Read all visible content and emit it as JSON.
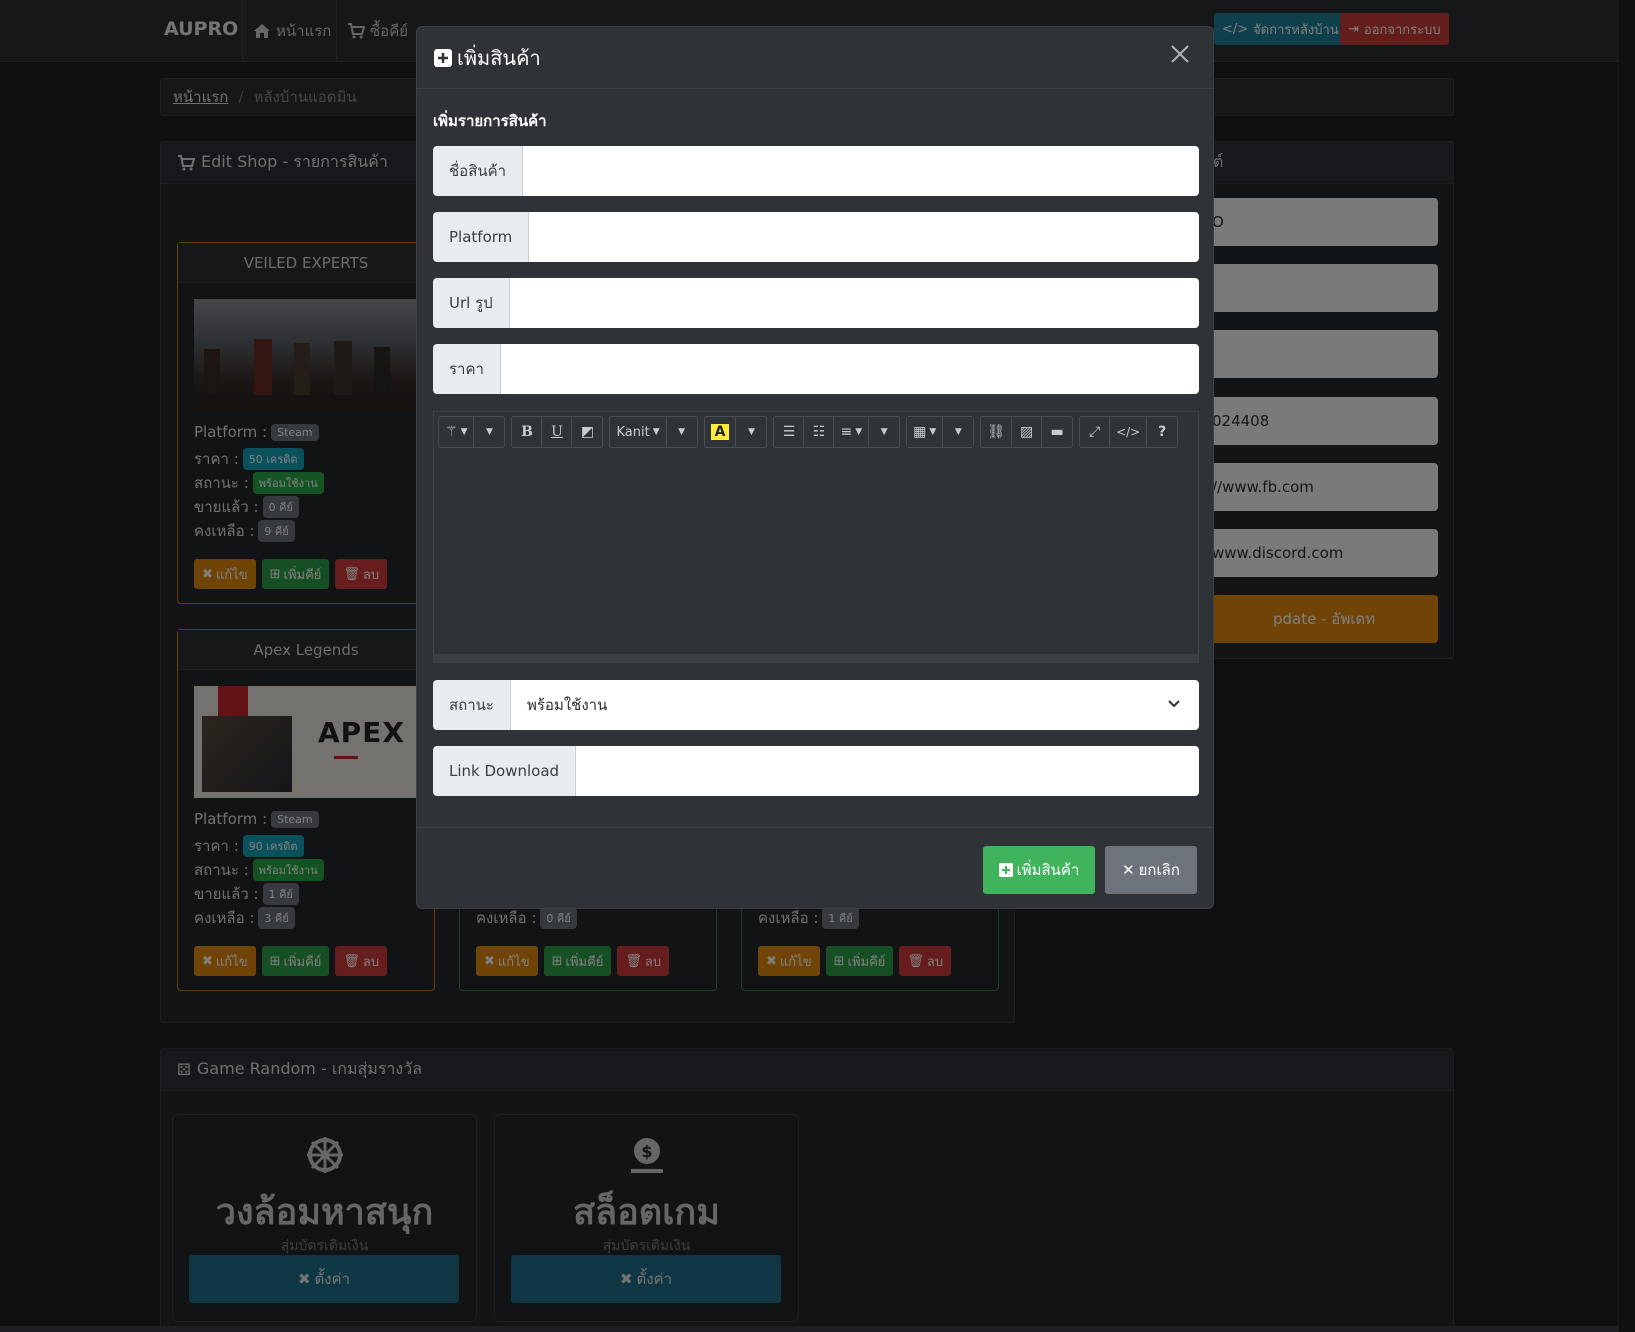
{
  "navbar": {
    "brand": "AUPRO",
    "items": [
      {
        "label": "หน้าแรก",
        "icon": "home-icon"
      },
      {
        "label": "ซื้อคีย์",
        "icon": "cart-icon"
      }
    ],
    "admin_btn": "จัดการหลังบ้าน",
    "logout_btn": "ออกจากระบบ"
  },
  "breadcrumb": {
    "home": "หน้าแรก",
    "separator": "/",
    "current": "หลังบ้านแอดมิน"
  },
  "shop_panel": {
    "title": "Edit Shop - รายการสินค้า",
    "labels": {
      "platform": "Platform :",
      "price": "ราคา :",
      "status": "สถานะ :",
      "sold": "ขายแล้ว :",
      "remaining": "คงเหลือ :"
    },
    "buttons": {
      "edit": "แก้ไข",
      "add_key": "เพิ่มคีย์",
      "delete": "ลบ"
    },
    "cards": [
      {
        "title": "VEILED EXPERTS",
        "platform": "Steam",
        "price": "50 เครดิต",
        "status": "พร้อมใช้งาน",
        "sold": "0 คีย์",
        "remaining": "9 คีย์"
      },
      {
        "title": "Apex Legends",
        "platform": "Steam",
        "price": "90 เครดิต",
        "status": "พร้อมใช้งาน",
        "sold": "1 คีย์",
        "remaining": "3 คีย์",
        "image_text": "APEX"
      },
      {
        "remaining": "0 คีย์"
      },
      {
        "remaining": "1 คีย์"
      }
    ]
  },
  "settings_panel": {
    "title_fragment": "ต์",
    "fields": [
      "O",
      "",
      "",
      "024408",
      "//www.fb.com",
      "www.discord.com"
    ],
    "update_btn": "pdate - อัพเดท"
  },
  "random_panel": {
    "title": "Game Random - เกมสุ่มรางวัล",
    "games": [
      {
        "title": "วงล้อมหาสนุก",
        "subtitle": "สุ่มบัตรเติมเงิน",
        "button": "ตั้งค่า",
        "icon": "wheel-icon"
      },
      {
        "title": "สล็อตเกม",
        "subtitle": "สุ่มบัตรเติมเงิน",
        "button": "ตั้งค่า",
        "icon": "money-bag-icon"
      }
    ]
  },
  "modal": {
    "title": "เพิ่มสินค้า",
    "subtitle": "เพิ่มรายการสินค้า",
    "fields": {
      "name_label": "ชื่อสินค้า",
      "platform_label": "Platform",
      "image_label": "Url รูป",
      "price_label": "ราคา",
      "status_label": "สถานะ",
      "status_value": "พร้อมใช้งาน",
      "download_label": "Link Download"
    },
    "toolbar": {
      "bold": "B",
      "underline": "U",
      "font": "Kanit",
      "color": "A",
      "code": "</>",
      "help": "?"
    },
    "submit_btn": "เพิ่มสินค้า",
    "cancel_btn": "ยกเลิก"
  },
  "colors": {
    "accent_green": "#3fb45c",
    "accent_orange": "#e0890f",
    "accent_teal": "#1f6f86",
    "danger": "#cf3b3b"
  }
}
